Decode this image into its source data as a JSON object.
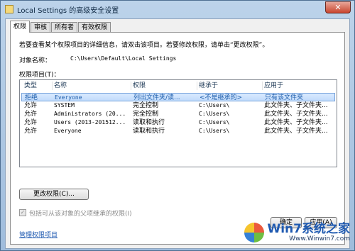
{
  "window": {
    "title": "Local Settings 的高级安全设置",
    "close_glyph": "✕"
  },
  "tabs": [
    "权限",
    "审核",
    "所有者",
    "有效权限"
  ],
  "intro_text": "若要查看某个权限项目的详细信息，请双击该项目。若要修改权限，请单击“更改权限”。",
  "object": {
    "label": "对象名称：",
    "value": "C:\\Users\\Default\\Local Settings"
  },
  "entries_label": "权限项目(T)：",
  "table": {
    "columns": [
      "类型",
      "名称",
      "权限",
      "继承于",
      "应用于"
    ],
    "rows": [
      [
        "拒绝",
        "Everyone",
        "列出文件夹/读...",
        "<不是继承的>",
        "只有该文件夹"
      ],
      [
        "允许",
        "SYSTEM",
        "完全控制",
        "C:\\Users\\",
        "此文件夹、子文件夹..."
      ],
      [
        "允许",
        "Administrators (20...",
        "完全控制",
        "C:\\Users\\",
        "此文件夹、子文件夹..."
      ],
      [
        "允许",
        "Users (2013-201512...",
        "读取和执行",
        "C:\\Users\\",
        "此文件夹、子文件夹..."
      ],
      [
        "允许",
        "Everyone",
        "读取和执行",
        "C:\\Users\\",
        "此文件夹、子文件夹..."
      ]
    ],
    "selected_row": 0
  },
  "change_button": "更改权限(C)...",
  "inherit_checkbox": {
    "checked": true,
    "label": "包括可从该对象的父项继承的权限(I)"
  },
  "manage_link": "管理权限项目",
  "buttons": {
    "ok": "确定",
    "apply": "应用(A)"
  },
  "watermark": {
    "main": "Win7系统之家",
    "sub": "Www.Winwin7.com"
  }
}
